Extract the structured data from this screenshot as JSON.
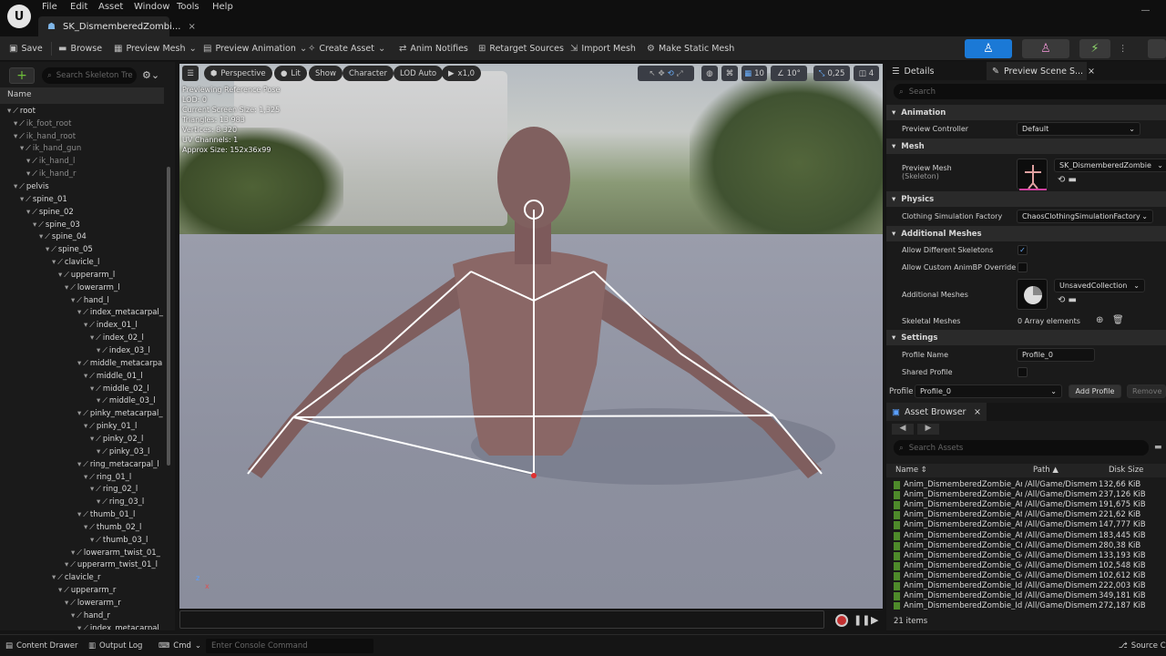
{
  "menu": [
    "File",
    "Edit",
    "Asset",
    "Window",
    "Tools",
    "Help"
  ],
  "doc_tab": {
    "title": "SK_DismemberedZombi...",
    "close": "×"
  },
  "toolbar": {
    "save": "Save",
    "browse": "Browse",
    "preview_mesh": "Preview Mesh",
    "preview_animation": "Preview Animation",
    "create_asset": "Create Asset",
    "anim_notifies": "Anim Notifies",
    "retarget_sources": "Retarget Sources",
    "import_mesh": "Import Mesh",
    "make_static_mesh": "Make Static Mesh"
  },
  "mode_colors": {
    "active": "#1b79d6",
    "inactive": "#3a3a3a"
  },
  "skeleton": {
    "search_placeholder": "Search Skeleton Tre",
    "name_header": "Name",
    "bones": [
      {
        "name": "root",
        "depth": 0,
        "dim": false
      },
      {
        "name": "ik_foot_root",
        "depth": 1,
        "dim": true
      },
      {
        "name": "ik_hand_root",
        "depth": 1,
        "dim": true
      },
      {
        "name": "ik_hand_gun",
        "depth": 2,
        "dim": true
      },
      {
        "name": "ik_hand_l",
        "depth": 3,
        "dim": true
      },
      {
        "name": "ik_hand_r",
        "depth": 3,
        "dim": true
      },
      {
        "name": "pelvis",
        "depth": 1,
        "dim": false
      },
      {
        "name": "spine_01",
        "depth": 2,
        "dim": false
      },
      {
        "name": "spine_02",
        "depth": 3,
        "dim": false
      },
      {
        "name": "spine_03",
        "depth": 4,
        "dim": false
      },
      {
        "name": "spine_04",
        "depth": 5,
        "dim": false
      },
      {
        "name": "spine_05",
        "depth": 6,
        "dim": false
      },
      {
        "name": "clavicle_l",
        "depth": 7,
        "dim": false
      },
      {
        "name": "upperarm_l",
        "depth": 8,
        "dim": false
      },
      {
        "name": "lowerarm_l",
        "depth": 9,
        "dim": false
      },
      {
        "name": "hand_l",
        "depth": 10,
        "dim": false
      },
      {
        "name": "index_metacarpal_",
        "depth": 11,
        "dim": false
      },
      {
        "name": "index_01_l",
        "depth": 12,
        "dim": false
      },
      {
        "name": "index_02_l",
        "depth": 13,
        "dim": false
      },
      {
        "name": "index_03_l",
        "depth": 14,
        "dim": false
      },
      {
        "name": "middle_metacarpa",
        "depth": 11,
        "dim": false
      },
      {
        "name": "middle_01_l",
        "depth": 12,
        "dim": false
      },
      {
        "name": "middle_02_l",
        "depth": 13,
        "dim": false
      },
      {
        "name": "middle_03_l",
        "depth": 14,
        "dim": false
      },
      {
        "name": "pinky_metacarpal_",
        "depth": 11,
        "dim": false
      },
      {
        "name": "pinky_01_l",
        "depth": 12,
        "dim": false
      },
      {
        "name": "pinky_02_l",
        "depth": 13,
        "dim": false
      },
      {
        "name": "pinky_03_l",
        "depth": 14,
        "dim": false
      },
      {
        "name": "ring_metacarpal_l",
        "depth": 11,
        "dim": false
      },
      {
        "name": "ring_01_l",
        "depth": 12,
        "dim": false
      },
      {
        "name": "ring_02_l",
        "depth": 13,
        "dim": false
      },
      {
        "name": "ring_03_l",
        "depth": 14,
        "dim": false
      },
      {
        "name": "thumb_01_l",
        "depth": 11,
        "dim": false
      },
      {
        "name": "thumb_02_l",
        "depth": 12,
        "dim": false
      },
      {
        "name": "thumb_03_l",
        "depth": 13,
        "dim": false
      },
      {
        "name": "lowerarm_twist_01_",
        "depth": 10,
        "dim": false
      },
      {
        "name": "upperarm_twist_01_l",
        "depth": 9,
        "dim": false
      },
      {
        "name": "clavicle_r",
        "depth": 7,
        "dim": false
      },
      {
        "name": "upperarm_r",
        "depth": 8,
        "dim": false
      },
      {
        "name": "lowerarm_r",
        "depth": 9,
        "dim": false
      },
      {
        "name": "hand_r",
        "depth": 10,
        "dim": false
      },
      {
        "name": "index_metacarpal",
        "depth": 11,
        "dim": false
      }
    ]
  },
  "viewport": {
    "perspective": "Perspective",
    "lit": "Lit",
    "show": "Show",
    "character": "Character",
    "lod": "LOD Auto",
    "speed": "x1,0",
    "grid": "10",
    "angle": "10°",
    "scale": "0,25",
    "cam": "4",
    "stats": [
      "Previewing Reference Pose",
      "LOD: 0",
      "Current Screen Size: 1,325",
      "Triangles: 13 983",
      "Vertices: 8 320",
      "UV Channels: 1",
      "Approx Size: 152x36x99"
    ],
    "console_placeholder": "Enter Console Command"
  },
  "details": {
    "tab_details": "Details",
    "tab_preview": "Preview Scene S...",
    "search_placeholder": "Search",
    "animation": "Animation",
    "preview_controller_label": "Preview Controller",
    "preview_controller_value": "Default",
    "mesh": "Mesh",
    "preview_mesh_label": "Preview Mesh",
    "preview_mesh_sub": "(Skeleton)",
    "preview_mesh_value": "SK_DismemberedZombie",
    "physics": "Physics",
    "clothing_label": "Clothing Simulation Factory",
    "clothing_value": "ChaosClothingSimulationFactory",
    "additional_meshes": "Additional Meshes",
    "allow_diff_skel": "Allow Different Skeletons",
    "allow_custom_anim": "Allow Custom AnimBP Override",
    "additional_meshes_label": "Additional Meshes",
    "unsaved_collection": "UnsavedCollection",
    "skeletal_meshes_label": "Skeletal Meshes",
    "skeletal_meshes_value": "0 Array elements",
    "settings": "Settings",
    "profile_name_label": "Profile Name",
    "profile_name_value": "Profile_0",
    "shared_profile_label": "Shared Profile",
    "profile_label": "Profile",
    "profile_value": "Profile_0",
    "add_profile": "Add Profile",
    "remove": "Remove"
  },
  "asset_browser": {
    "tab": "Asset Browser",
    "search_placeholder": "Search Assets",
    "col_name": "Name",
    "col_path": "Path",
    "col_size": "Disk Size",
    "rows": [
      {
        "name": "Anim_DismemberedZombie_Angry",
        "path": "/All/Game/Dismem",
        "size": "132,66 KiB"
      },
      {
        "name": "Anim_DismemberedZombie_Angry",
        "path": "/All/Game/Dismem",
        "size": "237,126 KiB"
      },
      {
        "name": "Anim_DismemberedZombie_Attac",
        "path": "/All/Game/Dismem",
        "size": "191,675 KiB"
      },
      {
        "name": "Anim_DismemberedZombie_Attac",
        "path": "/All/Game/Dismem",
        "size": "221,62 KiB"
      },
      {
        "name": "Anim_DismemberedZombie_Attac",
        "path": "/All/Game/Dismem",
        "size": "147,777 KiB"
      },
      {
        "name": "Anim_DismemberedZombie_Attac",
        "path": "/All/Game/Dismem",
        "size": "183,445 KiB"
      },
      {
        "name": "Anim_DismemberedZombie_Craw",
        "path": "/All/Game/Dismem",
        "size": "280,38 KiB"
      },
      {
        "name": "Anim_DismemberedZombie_GetHi",
        "path": "/All/Game/Dismem",
        "size": "133,193 KiB"
      },
      {
        "name": "Anim_DismemberedZombie_GetHi",
        "path": "/All/Game/Dismem",
        "size": "102,548 KiB"
      },
      {
        "name": "Anim_DismemberedZombie_GetHi",
        "path": "/All/Game/Dismem",
        "size": "102,612 KiB"
      },
      {
        "name": "Anim_DismemberedZombie_Idle_1",
        "path": "/All/Game/Dismem",
        "size": "222,003 KiB"
      },
      {
        "name": "Anim_DismemberedZombie_Idle_2",
        "path": "/All/Game/Dismem",
        "size": "349,181 KiB"
      },
      {
        "name": "Anim_DismemberedZombie_Idle_3",
        "path": "/All/Game/Dismem",
        "size": "272,187 KiB"
      }
    ],
    "count": "21 items"
  },
  "statusbar": {
    "content_drawer": "Content Drawer",
    "output_log": "Output Log",
    "cmd": "Cmd",
    "console_placeholder": "Enter Console Command",
    "source_control": "Source Co"
  }
}
